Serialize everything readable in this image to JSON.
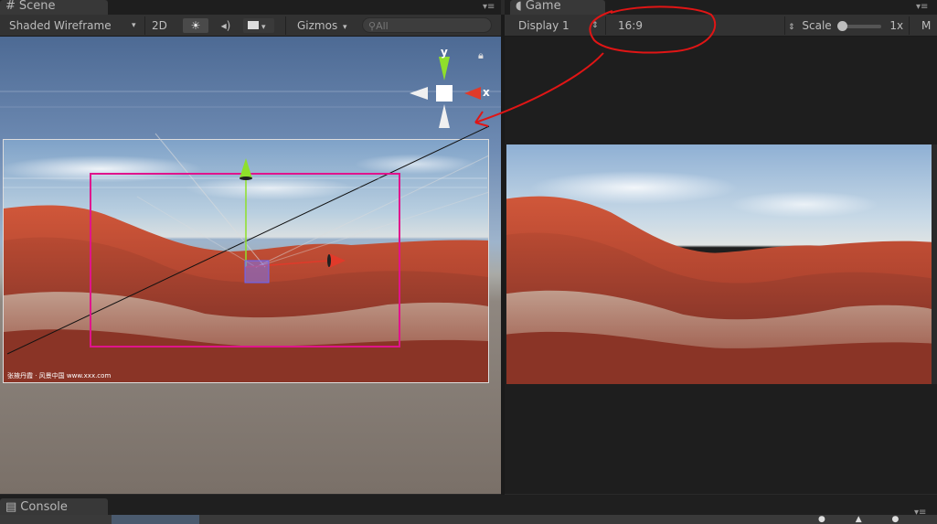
{
  "scene": {
    "tab_label": "Scene",
    "shading_mode": "Shaded Wireframe",
    "mode_2d": "2D",
    "gizmos_label": "Gizmos",
    "search_placeholder": "All",
    "axis_y": "y",
    "axis_x": "x",
    "watermark": "张掖丹霞 · 风景中国 www.xxx.com"
  },
  "game": {
    "tab_label": "Game",
    "display": "Display 1",
    "aspect": "16:9",
    "scale_label": "Scale",
    "scale_value": "1x",
    "maximize_label": "M"
  },
  "console": {
    "tab_label": "Console"
  },
  "colors": {
    "annotation_red": "#e01515",
    "selection_magenta": "#e0148c",
    "gizmo_green": "#8fe02a",
    "gizmo_red": "#e03a2a"
  }
}
